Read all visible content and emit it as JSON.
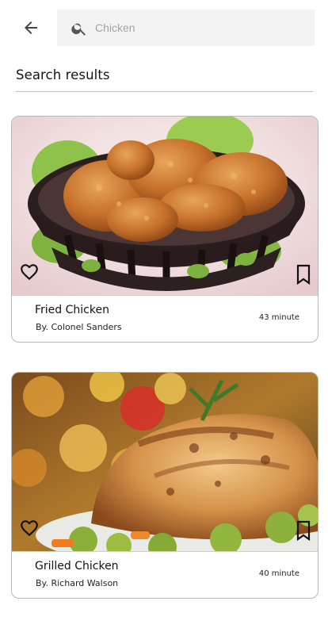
{
  "header": {
    "back_icon": "arrow-left-icon",
    "search": {
      "placeholder": "Chicken",
      "value": "",
      "icon": "search-icon"
    }
  },
  "section": {
    "title": "Search results"
  },
  "results": [
    {
      "name": "Fried Chicken",
      "author": "By. Colonel Sanders",
      "time": "43 minute",
      "image": "fried chicken in basket",
      "favorite_icon": "heart-outline-icon",
      "bookmark_icon": "bookmark-outline-icon"
    },
    {
      "name": "Grilled Chicken",
      "author": "By. Richard Walson",
      "time": "40 minute",
      "image": "grilled chicken on plate",
      "favorite_icon": "heart-outline-icon",
      "bookmark_icon": "bookmark-outline-icon"
    }
  ],
  "colors": {
    "background": "#ffffff",
    "search_bg": "#f3f3f3",
    "placeholder": "#a3a3a3",
    "divider": "#bdbdbd",
    "card_border": "#b7b7b7"
  }
}
